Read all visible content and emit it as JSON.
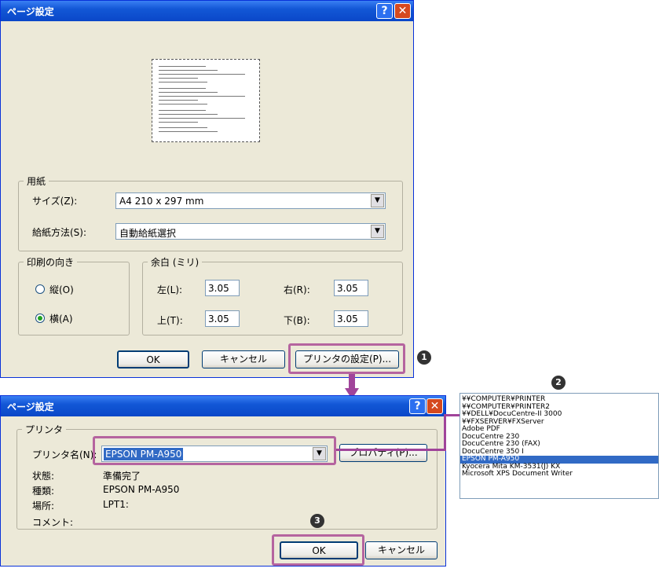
{
  "dialog1": {
    "title": "ページ設定",
    "help": "?",
    "close": "✕",
    "paper": {
      "legend": "用紙",
      "size_label": "サイズ(Z):",
      "size_value": "A4 210 x 297 mm",
      "source_label": "給紙方法(S):",
      "source_value": "自動給紙選択"
    },
    "orientation": {
      "legend": "印刷の向き",
      "portrait": "縦(O)",
      "landscape": "横(A)"
    },
    "margins": {
      "legend": "余白 (ミリ)",
      "left_label": "左(L):",
      "left_value": "3.05",
      "right_label": "右(R):",
      "right_value": "3.05",
      "top_label": "上(T):",
      "top_value": "3.05",
      "bottom_label": "下(B):",
      "bottom_value": "3.05"
    },
    "buttons": {
      "ok": "OK",
      "cancel": "キャンセル",
      "printer": "プリンタの設定(P)..."
    }
  },
  "dialog2": {
    "title": "ページ設定",
    "help": "?",
    "close": "✕",
    "printer_legend": "プリンタ",
    "name_label": "プリンタ名(N):",
    "name_value": "EPSON PM-A950",
    "properties": "プロパティ(P)...",
    "status_label": "状態:",
    "status_value": "準備完了",
    "type_label": "種類:",
    "type_value": "EPSON PM-A950",
    "location_label": "場所:",
    "location_value": "LPT1:",
    "comment_label": "コメント:",
    "ok": "OK",
    "cancel": "キャンセル"
  },
  "printer_list": [
    "¥¥COMPUTER¥PRINTER",
    "¥¥COMPUTER¥PRINTER2",
    "¥¥DELL¥DocuCentre-II 3000",
    "¥¥FXSERVER¥FXServer",
    "Adobe PDF",
    "DocuCentre 230",
    "DocuCentre 230 (FAX)",
    "DocuCentre 350 I",
    "EPSON PM-A950",
    "Kyocera Mita KM-3531(J) KX",
    "Microsoft XPS Document Writer"
  ],
  "printer_list_selected": "EPSON PM-A950",
  "steps": {
    "one": "1",
    "two": "2",
    "three": "3"
  },
  "colors": {
    "highlight": "#b5649f",
    "arrow": "#a0449a",
    "selection": "#316ac5"
  }
}
